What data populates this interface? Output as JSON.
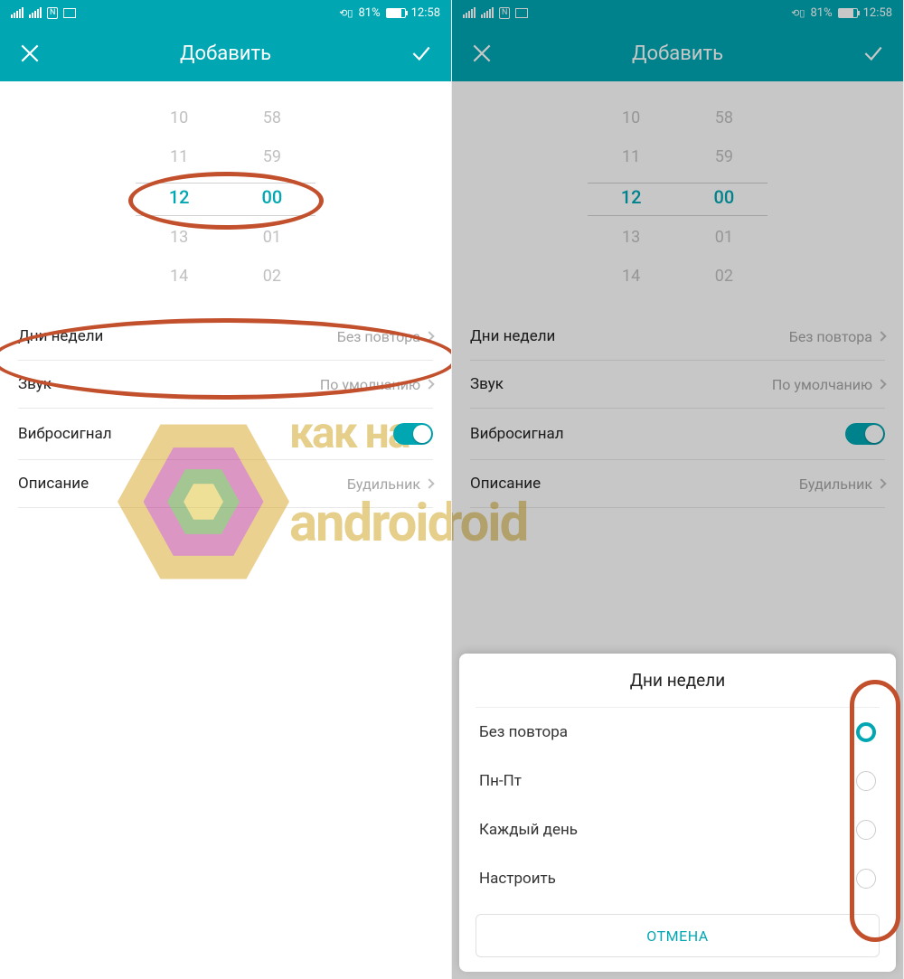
{
  "status": {
    "battery_pct": "81%",
    "time": "12:58",
    "nfc_label": "N"
  },
  "header": {
    "title": "Добавить"
  },
  "picker": {
    "hours": [
      "10",
      "11",
      "12",
      "13",
      "14"
    ],
    "mins": [
      "58",
      "59",
      "00",
      "01",
      "02"
    ],
    "selected_hour": "12",
    "selected_min": "00"
  },
  "rows": {
    "repeat": {
      "label": "Дни недели",
      "value": "Без повтора"
    },
    "sound": {
      "label": "Звук",
      "value": "По умолчанию"
    },
    "vibrate": {
      "label": "Вибросигнал",
      "on": true
    },
    "desc": {
      "label": "Описание",
      "value": "Будильник"
    }
  },
  "sheet": {
    "title": "Дни недели",
    "options": [
      {
        "label": "Без повтора",
        "checked": true
      },
      {
        "label": "Пн-Пт",
        "checked": false
      },
      {
        "label": "Каждый день",
        "checked": false
      },
      {
        "label": "Настроить",
        "checked": false
      }
    ],
    "cancel": "ОТМЕНА"
  },
  "watermark": {
    "line1": "как на",
    "line2": "android"
  }
}
